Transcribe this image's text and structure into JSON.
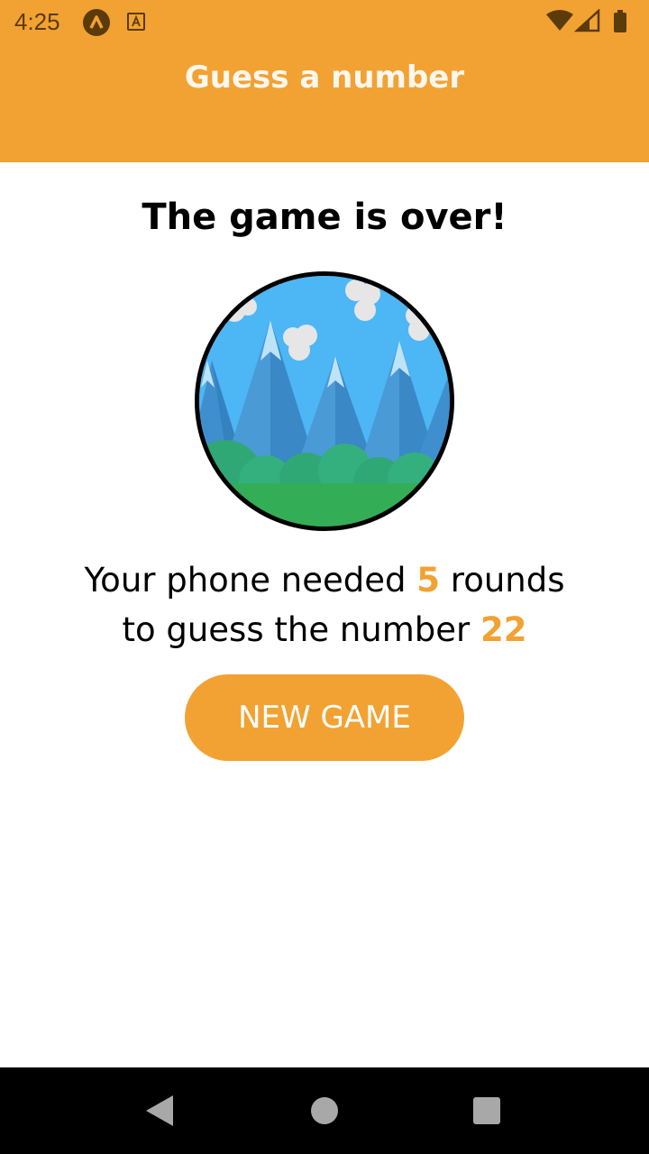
{
  "status_bar": {
    "time": "4:25",
    "left_icons": [
      "app-notification-icon",
      "accessibility-icon"
    ],
    "right_icons": [
      "wifi-icon",
      "cell-signal-icon",
      "battery-icon"
    ]
  },
  "header": {
    "title": "Guess a number"
  },
  "main": {
    "title": "The game is over!",
    "image_alt": "mountain landscape illustration",
    "summary": {
      "part1": "Your phone needed ",
      "rounds": "5",
      "part2": " rounds",
      "part3": "to guess the number ",
      "number": "22"
    },
    "new_game_label": "NEW GAME"
  },
  "nav_bar": {
    "icons": [
      "back-icon",
      "home-icon",
      "recents-icon"
    ]
  },
  "colors": {
    "accent": "#F2A232",
    "text": "#000000",
    "background": "#FFFFFF"
  }
}
